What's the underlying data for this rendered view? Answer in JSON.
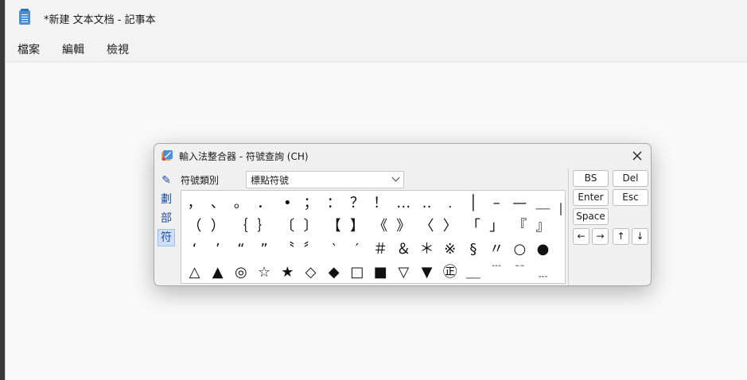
{
  "notepad": {
    "title": "*新建 文本文档 - 記事本",
    "menu": [
      "檔案",
      "編輯",
      "檢視"
    ]
  },
  "dialog": {
    "title": "輸入法整合器 - 符號查詢 (CH)",
    "close_icon": "close-icon",
    "side_tools": [
      "✎",
      "劃",
      "部",
      "符"
    ],
    "category_label": "符號類別",
    "category_value": "標點符號",
    "symbols": [
      [
        "，",
        "、",
        "。",
        "．",
        "•",
        "；",
        "：",
        "？",
        "！",
        "…",
        "‥",
        "﹒",
        "│",
        "–",
        "—",
        "＿"
      ],
      [
        "（",
        "）",
        "｛",
        "｝",
        "〔",
        "〕",
        "【",
        "】",
        "《",
        "》",
        "〈",
        "〉",
        "「",
        "」",
        "『",
        "』"
      ],
      [
        "‘",
        "’",
        "“",
        "”",
        "〝",
        "〞",
        "‵",
        "′",
        "＃",
        "＆",
        "＊",
        "※",
        "§",
        "〃",
        "○",
        "●"
      ],
      [
        "△",
        "▲",
        "◎",
        "☆",
        "★",
        "◇",
        "◆",
        "□",
        "■",
        "▽",
        "▼",
        "㊣",
        "＿",
        "﹉",
        "﹊",
        "﹍"
      ]
    ],
    "keys": {
      "bs": "BS",
      "del": "Del",
      "enter": "Enter",
      "esc": "Esc",
      "space": "Space",
      "left": "←",
      "right": "→",
      "up": "↑",
      "down": "↓"
    }
  }
}
